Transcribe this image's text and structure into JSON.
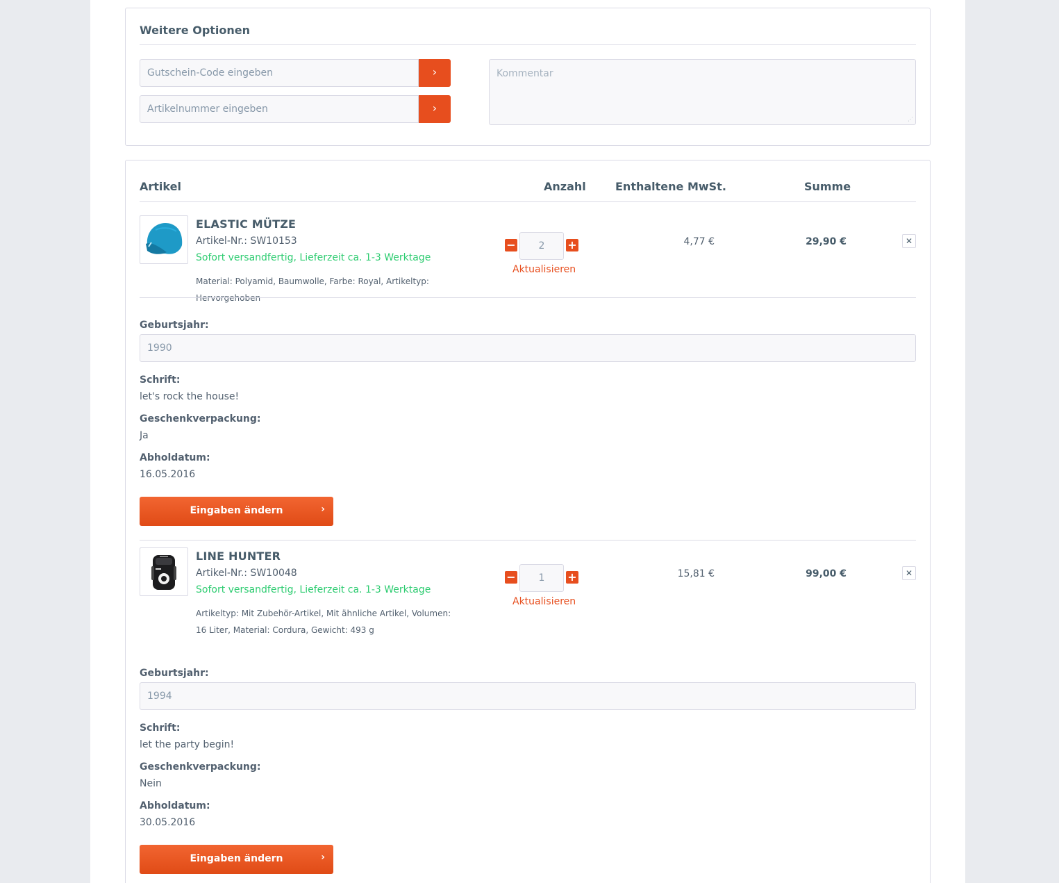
{
  "options": {
    "title": "Weitere Optionen",
    "voucher_placeholder": "Gutschein-Code eingeben",
    "article_placeholder": "Artikelnummer eingeben",
    "submit_glyph": "›",
    "comment_placeholder": "Kommentar"
  },
  "cart": {
    "headers": {
      "article": "Artikel",
      "quantity": "Anzahl",
      "vat": "Enthaltene MwSt.",
      "sum": "Summe"
    },
    "items": [
      {
        "name": "ELASTIC MÜTZE",
        "number": "Artikel-Nr.: SW10153",
        "delivery": "Sofort versandfertig, Lieferzeit ca. 1-3 Werktage",
        "properties": "Material: Polyamid, Baumwolle, Farbe: Royal, Artikeltyp: Hervorgehoben",
        "quantity": "2",
        "update": "Aktualisieren",
        "vat": "4,77 €",
        "sum": "29,90 €",
        "remove": "✕",
        "fields": [
          {
            "label": "Geburtsjahr:",
            "value": "1990"
          },
          {
            "label": "Schrift:",
            "value": "let's rock the house!"
          },
          {
            "label": "Geschenkverpackung:",
            "value": "Ja"
          },
          {
            "label": "Abholdatum:",
            "value": "16.05.2016"
          }
        ],
        "change_label": "Eingaben ändern",
        "thumb_icon": "beanie-hat-icon"
      },
      {
        "name": "LINE HUNTER",
        "number": "Artikel-Nr.: SW10048",
        "delivery": "Sofort versandfertig, Lieferzeit ca. 1-3 Werktage",
        "properties": "Artikeltyp: Mit Zubehör-Artikel, Mit ähnliche Artikel, Volumen: 16 Liter, Material: Cordura, Gewicht: 493 g",
        "quantity": "1",
        "update": "Aktualisieren",
        "vat": "15,81 €",
        "sum": "99,00 €",
        "remove": "✕",
        "fields": [
          {
            "label": "Geburtsjahr:",
            "value": "1994"
          },
          {
            "label": "Schrift:",
            "value": "let the party begin!"
          },
          {
            "label": "Geschenkverpackung:",
            "value": "Nein"
          },
          {
            "label": "Abholdatum:",
            "value": "30.05.2016"
          }
        ],
        "change_label": "Eingaben ändern",
        "thumb_icon": "backpack-icon"
      }
    ],
    "minus_glyph": "−",
    "plus_glyph": "+",
    "chevron_glyph": "›"
  },
  "colors": {
    "accent": "#e74e1e",
    "delivery_green": "#2ecc71",
    "border": "#dadae5",
    "text": "#52606f",
    "heading": "#475c6a"
  }
}
